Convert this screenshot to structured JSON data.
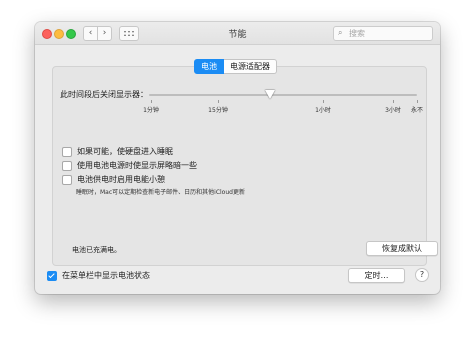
{
  "window": {
    "title": "节能",
    "search_placeholder": "搜索"
  },
  "tabs": [
    {
      "label": "电池",
      "active": true
    },
    {
      "label": "电源适配器",
      "active": false
    }
  ],
  "display_off": {
    "label": "此时间段后关闭显示器：",
    "ticks": [
      "1分钟",
      "15分钟",
      "1小时",
      "3小时",
      "永不"
    ],
    "value_fraction": 0.45
  },
  "options": [
    {
      "label": "如果可能，使硬盘进入睡眠",
      "checked": false
    },
    {
      "label": "使用电池电源时使显示屏略暗一些",
      "checked": false
    },
    {
      "label": "电池供电时启用电能小憩",
      "checked": false
    }
  ],
  "power_nap_note": "睡眠时，Mac可以定期检查新电子邮件、日历和其他iCloud更新",
  "battery_status": "电池已充满电。",
  "restore_defaults_label": "恢复成默认",
  "menubar_option": {
    "label": "在菜单栏中显示电池状态",
    "checked": true
  },
  "schedule_label": "定时…",
  "help_label": "?",
  "colors": {
    "accent": "#1b8cf4"
  }
}
